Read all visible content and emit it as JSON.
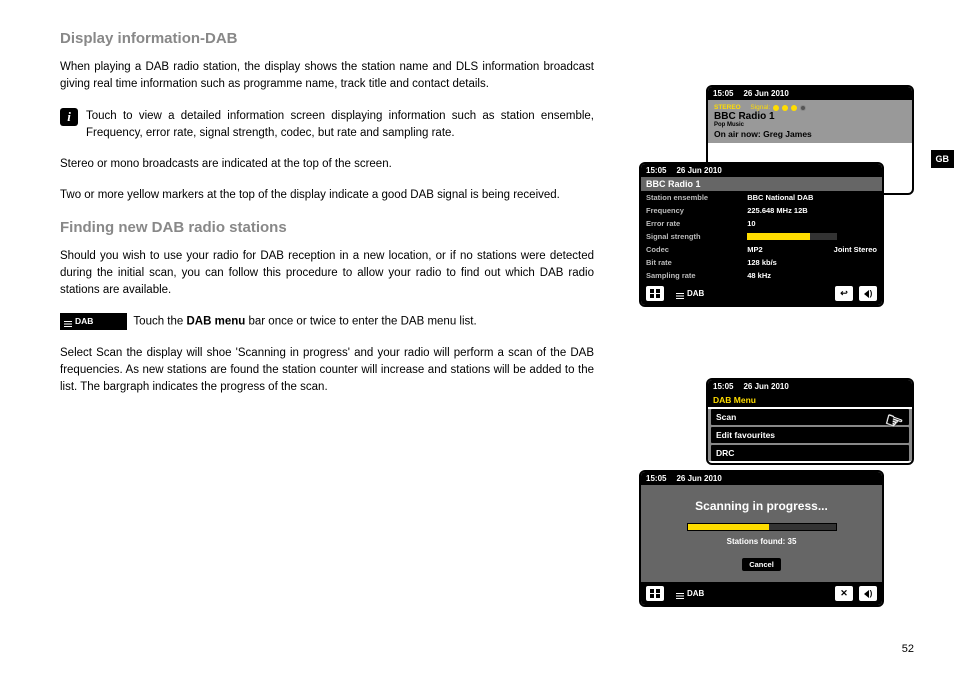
{
  "page_number": "52",
  "gb_tab": "GB",
  "headings": {
    "h1": "Display information-DAB",
    "h2": "Finding new DAB radio stations"
  },
  "paragraphs": {
    "p1": "When playing a DAB radio station, the display shows the station name and DLS information broadcast giving real time information such as programme name, track title and contact details.",
    "p2": "Touch to view a detailed information screen displaying information such as station ensemble, Frequency, error rate, signal strength, codec, but rate and sampling rate.",
    "p3": "Stereo or mono broadcasts are indicated at the top of the screen.",
    "p4": "Two or more yellow markers at the top of the display indicate a good DAB signal is being received.",
    "p5": "Should you wish to use your radio for DAB reception in a new location, or if no stations were detected during the initial scan, you can follow this procedure to allow your radio to find out which DAB radio stations are available.",
    "p6_prefix": "DAB",
    "p6_before": "Touch the ",
    "p6_bold": "DAB menu",
    "p6_after": " bar once or twice to enter the DAB menu list.",
    "p7": "Select Scan the display will shoe 'Scanning in progress' and your radio will perform a scan of the DAB frequencies. As new stations are found the station counter will increase and stations will be added to the list. The bargraph indicates the progress of the scan."
  },
  "shared": {
    "time": "15:05",
    "date": "26 Jun 2010",
    "dab_label": "DAB"
  },
  "screen1": {
    "stereo": "STEREO",
    "signal_label": "Signal:",
    "station": "BBC Radio 1",
    "genre": "Pop Music",
    "now": "On air now: Greg James"
  },
  "screen2": {
    "title": "BBC Radio 1",
    "rows": {
      "ensemble_l": "Station ensemble",
      "ensemble_v": "BBC National DAB",
      "freq_l": "Frequency",
      "freq_v": "225.648 MHz 12B",
      "err_l": "Error rate",
      "err_v": "10",
      "sig_l": "Signal strength",
      "codec_l": "Codec",
      "codec_v": "MP2",
      "codec_v2": "Joint Stereo",
      "bit_l": "Bit rate",
      "bit_v": "128 kb/s",
      "samp_l": "Sampling rate",
      "samp_v": "48 kHz"
    }
  },
  "screen3": {
    "menutitle": "DAB Menu",
    "items": {
      "scan": "Scan",
      "edit": "Edit favourites",
      "drc": "DRC"
    }
  },
  "screen4": {
    "msg": "Scanning in progress...",
    "found": "Stations found: 35",
    "cancel": "Cancel"
  }
}
